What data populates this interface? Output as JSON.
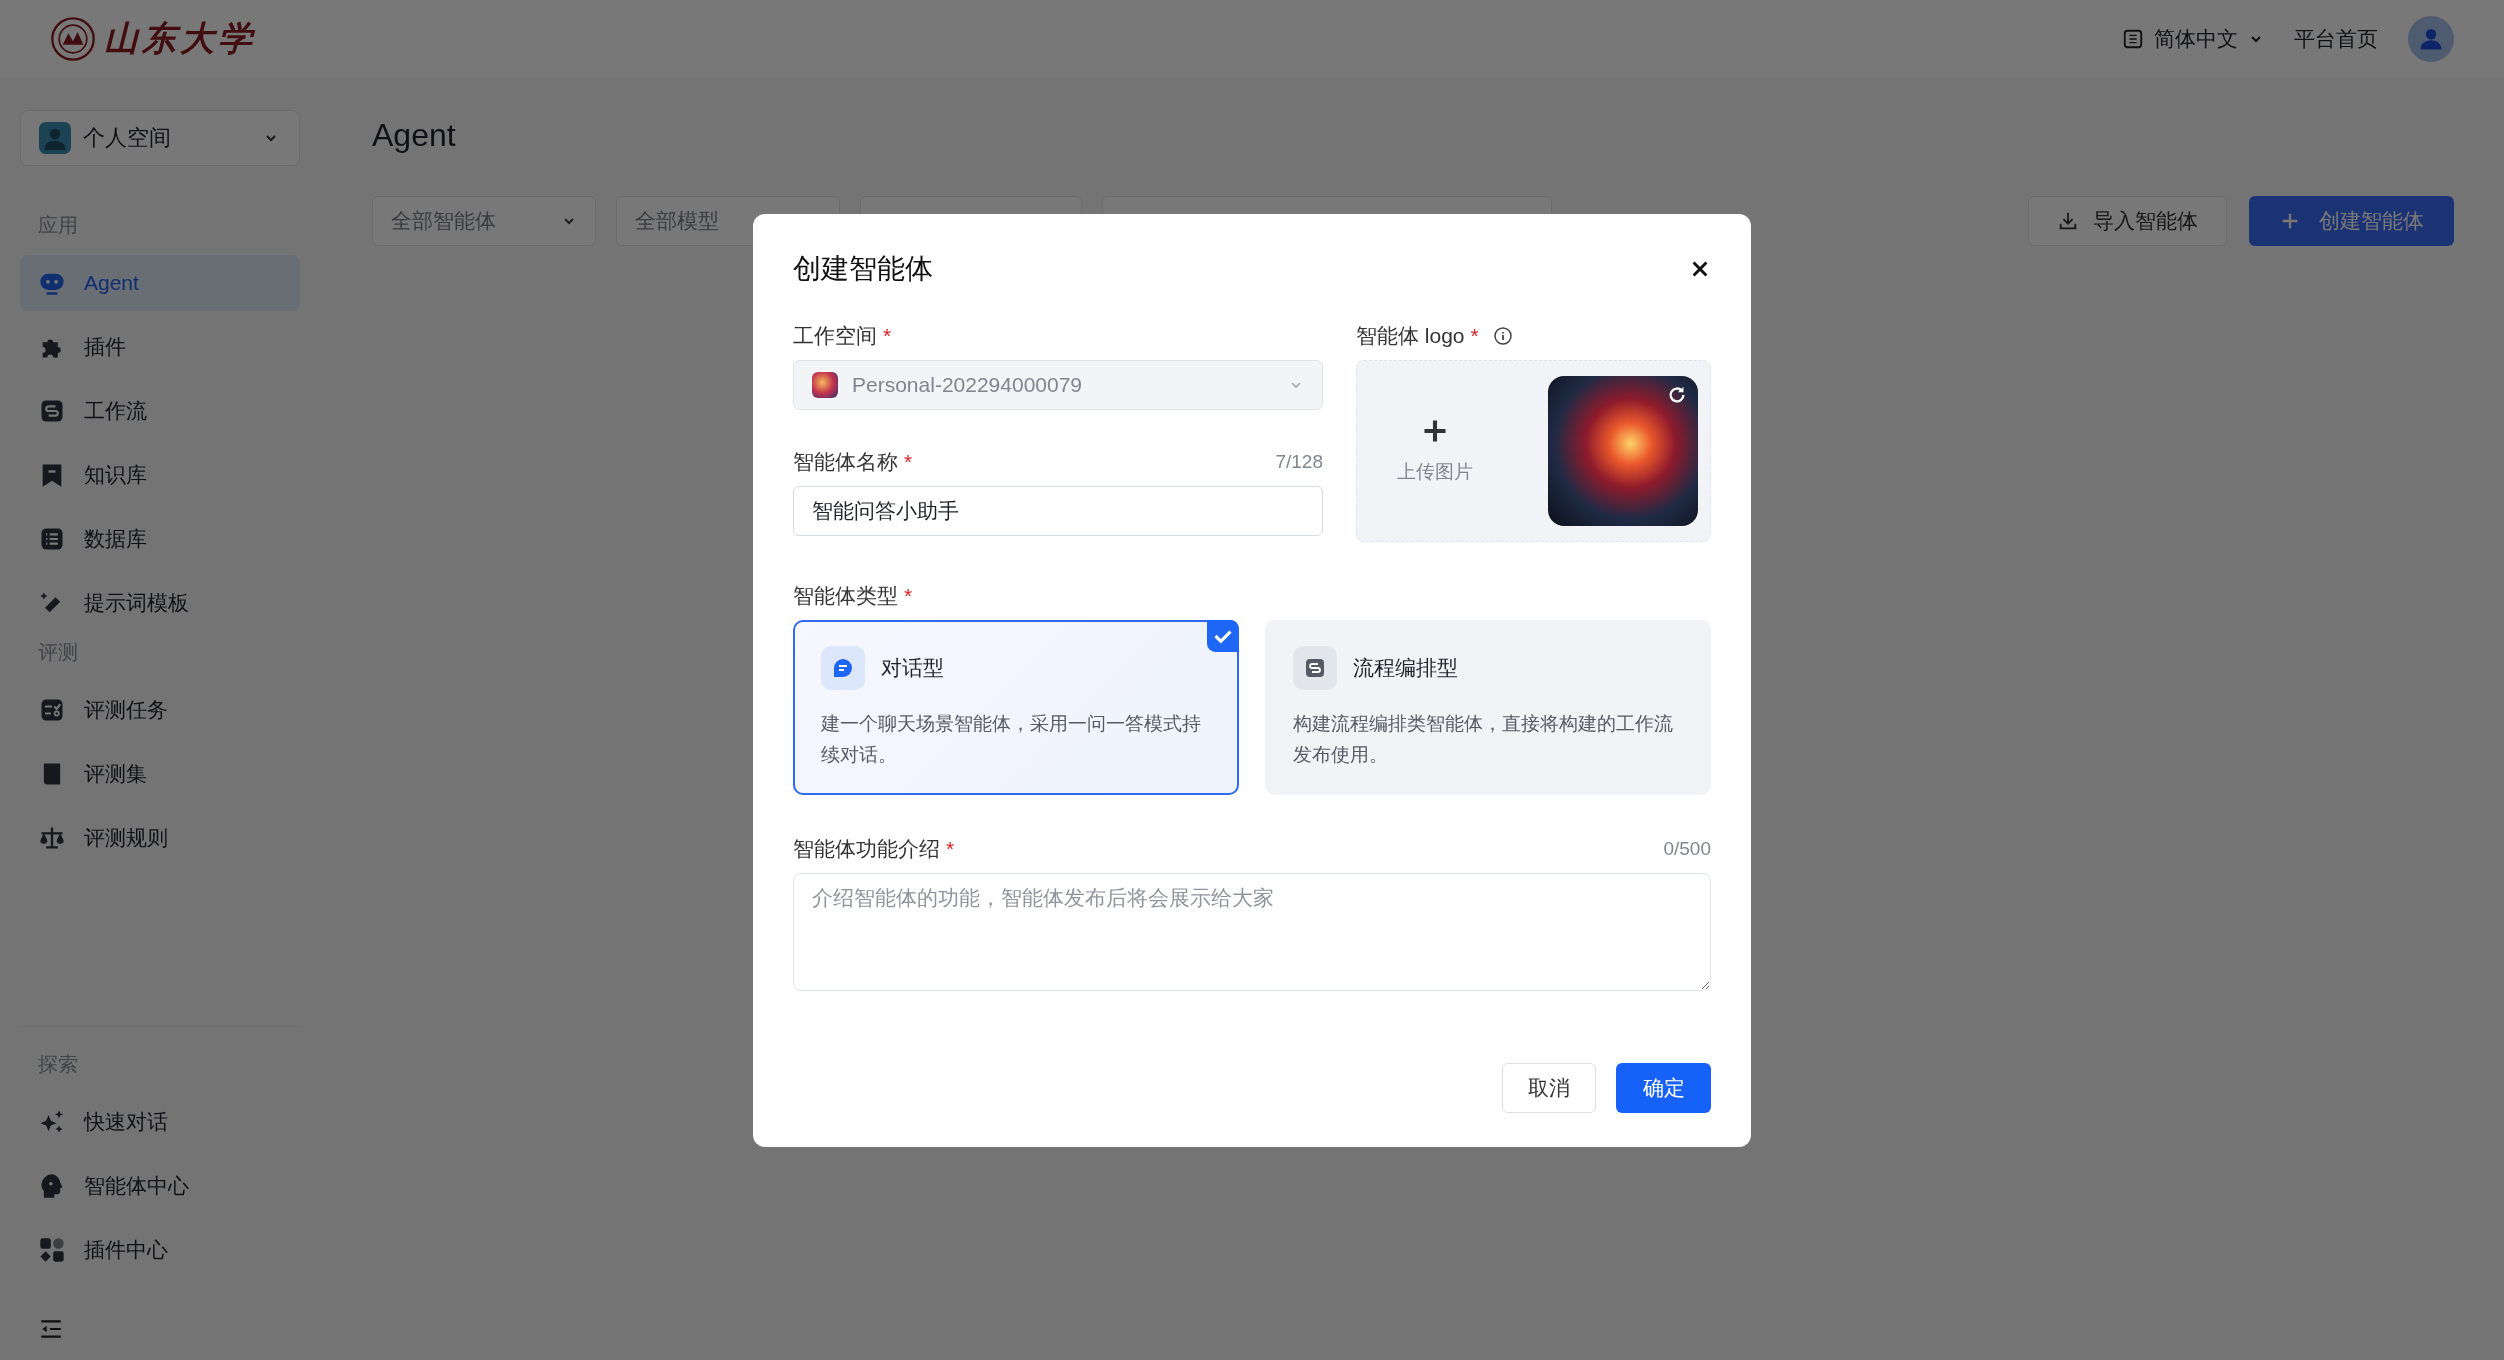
{
  "header": {
    "logo_text": "山东大学",
    "language": "简体中文",
    "home_link": "平台首页"
  },
  "sidebar": {
    "workspace": "个人空间",
    "sections": [
      {
        "title": "应用",
        "items": [
          {
            "label": "Agent",
            "selected": true
          },
          {
            "label": "插件",
            "selected": false
          },
          {
            "label": "工作流",
            "selected": false
          },
          {
            "label": "知识库",
            "selected": false
          },
          {
            "label": "数据库",
            "selected": false
          },
          {
            "label": "提示词模板",
            "selected": false
          }
        ]
      },
      {
        "title": "评测",
        "items": [
          {
            "label": "评测任务",
            "selected": false
          },
          {
            "label": "评测集",
            "selected": false
          },
          {
            "label": "评测规则",
            "selected": false
          }
        ]
      },
      {
        "title": "探索",
        "items": [
          {
            "label": "快速对话",
            "selected": false
          },
          {
            "label": "智能体中心",
            "selected": false
          },
          {
            "label": "插件中心",
            "selected": false
          }
        ]
      }
    ]
  },
  "main": {
    "title": "Agent",
    "filters": [
      "全部智能体",
      "全部模型"
    ],
    "import_button": "导入智能体",
    "create_button": "创建智能体"
  },
  "dialog": {
    "title": "创建智能体",
    "workspace": {
      "label": "工作空间",
      "required_mark": "*",
      "value": "Personal-202294000079",
      "disabled": true
    },
    "name": {
      "label": "智能体名称",
      "required_mark": "*",
      "count": "7/128",
      "value": "智能问答小助手"
    },
    "logo": {
      "label": "智能体 logo",
      "required_mark": "*",
      "upload_label": "上传图片"
    },
    "type": {
      "label": "智能体类型",
      "required_mark": "*",
      "options": [
        {
          "title": "对话型",
          "description": "建一个聊天场景智能体，采用一问一答模式持续对话。",
          "selected": true
        },
        {
          "title": "流程编排型",
          "description": "构建流程编排类智能体，直接将构建的工作流发布使用。",
          "selected": false
        }
      ]
    },
    "description": {
      "label": "智能体功能介绍",
      "required_mark": "*",
      "count": "0/500",
      "placeholder": "介绍智能体的功能，智能体发布后将会展示给大家"
    },
    "cancel_button": "取消",
    "confirm_button": "确定"
  }
}
